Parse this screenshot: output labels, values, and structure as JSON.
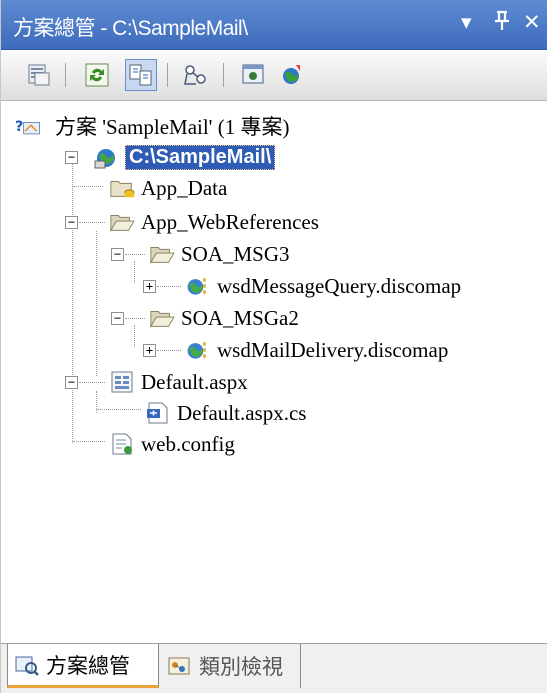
{
  "window": {
    "title": "方案總管 - C:\\SampleMail\\",
    "controls": {
      "dropdown": "▾",
      "pin": "ᵖ",
      "close": "✕"
    }
  },
  "toolbar": {
    "buttons": [
      "properties",
      "refresh",
      "nest-related-files",
      "view-class-diagram",
      "copy-website",
      "asp-net-configuration"
    ]
  },
  "tree": {
    "solution": "方案 'SampleMail' (1 專案)",
    "project": "C:\\SampleMail\\",
    "app_data": "App_Data",
    "app_webrefs": "App_WebReferences",
    "soa_msg3": "SOA_MSG3",
    "discomap1": "wsdMessageQuery.discomap",
    "soa_msga2": "SOA_MSGa2",
    "discomap2": "wsdMailDelivery.discomap",
    "default_aspx": "Default.aspx",
    "default_cs": "Default.aspx.cs",
    "web_config": "web.config",
    "expand_plus": "+",
    "expand_minus": "−"
  },
  "tabs": {
    "solution_explorer": "方案總管",
    "class_view": "類別檢視"
  },
  "colors": {
    "title_bar": "#3e6cbc",
    "selection": "#2d5bb5",
    "active_tab_accent": "#e8a33a"
  }
}
